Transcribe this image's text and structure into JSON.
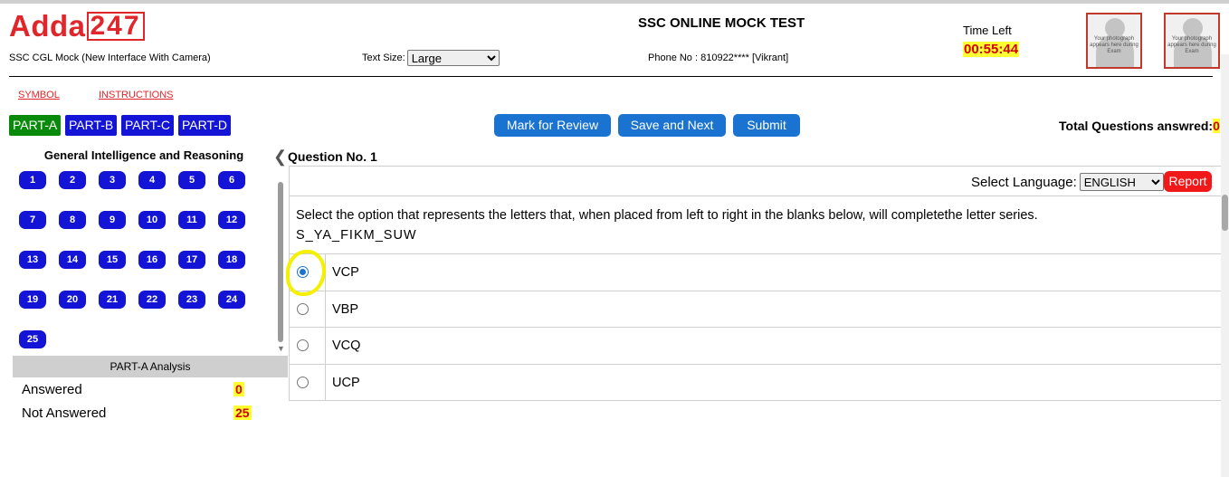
{
  "header": {
    "logo_text": "Adda",
    "logo_num": "247",
    "exam_name": "SSC CGL Mock (New Interface With Camera)",
    "text_size_label": "Text Size:",
    "text_size_value": "Large",
    "title": "SSC ONLINE MOCK TEST",
    "phone": "Phone No : 810922**** [Vikrant]",
    "time_left_label": "Time Left",
    "time_left_value": "00:55:44",
    "photo_text": "Your photograph appears here during Exam"
  },
  "links": {
    "symbol": "SYMBOL",
    "instructions": "INSTRUCTIONS"
  },
  "parts": [
    "PART-A",
    "PART-B",
    "PART-C",
    "PART-D"
  ],
  "actions": {
    "mark_review": "Mark for Review",
    "save_next": "Save and Next",
    "submit": "Submit"
  },
  "total_answered": {
    "label": "Total Questions answred:",
    "value": "0"
  },
  "palette": {
    "section_title": "General Intelligence and Reasoning",
    "questions": [
      "1",
      "2",
      "3",
      "4",
      "5",
      "6",
      "7",
      "8",
      "9",
      "10",
      "11",
      "12",
      "13",
      "14",
      "15",
      "16",
      "17",
      "18",
      "19",
      "20",
      "21",
      "22",
      "23",
      "24",
      "25"
    ]
  },
  "analysis": {
    "title": "PART-A Analysis",
    "answered_label": "Answered",
    "answered_value": "0",
    "not_answered_label": "Not Answered",
    "not_answered_value": "25"
  },
  "question": {
    "number_label": "Question No. 1",
    "language_label": "Select Language:",
    "language_value": "ENGLISH",
    "report": "Report",
    "text": "Select the option that represents the letters that, when placed from left to right in the blanks below, will completethe letter series.",
    "series": "S_YA_FIKM_SUW",
    "options": [
      "VCP",
      "VBP",
      "VCQ",
      "UCP"
    ],
    "selected_index": 0
  },
  "colors": {
    "accent_red": "#e0262a",
    "part_active": "#0a8a0a",
    "part_normal": "#1414d6",
    "action_blue": "#1a73d1",
    "highlight_yellow": "#ffff33"
  }
}
